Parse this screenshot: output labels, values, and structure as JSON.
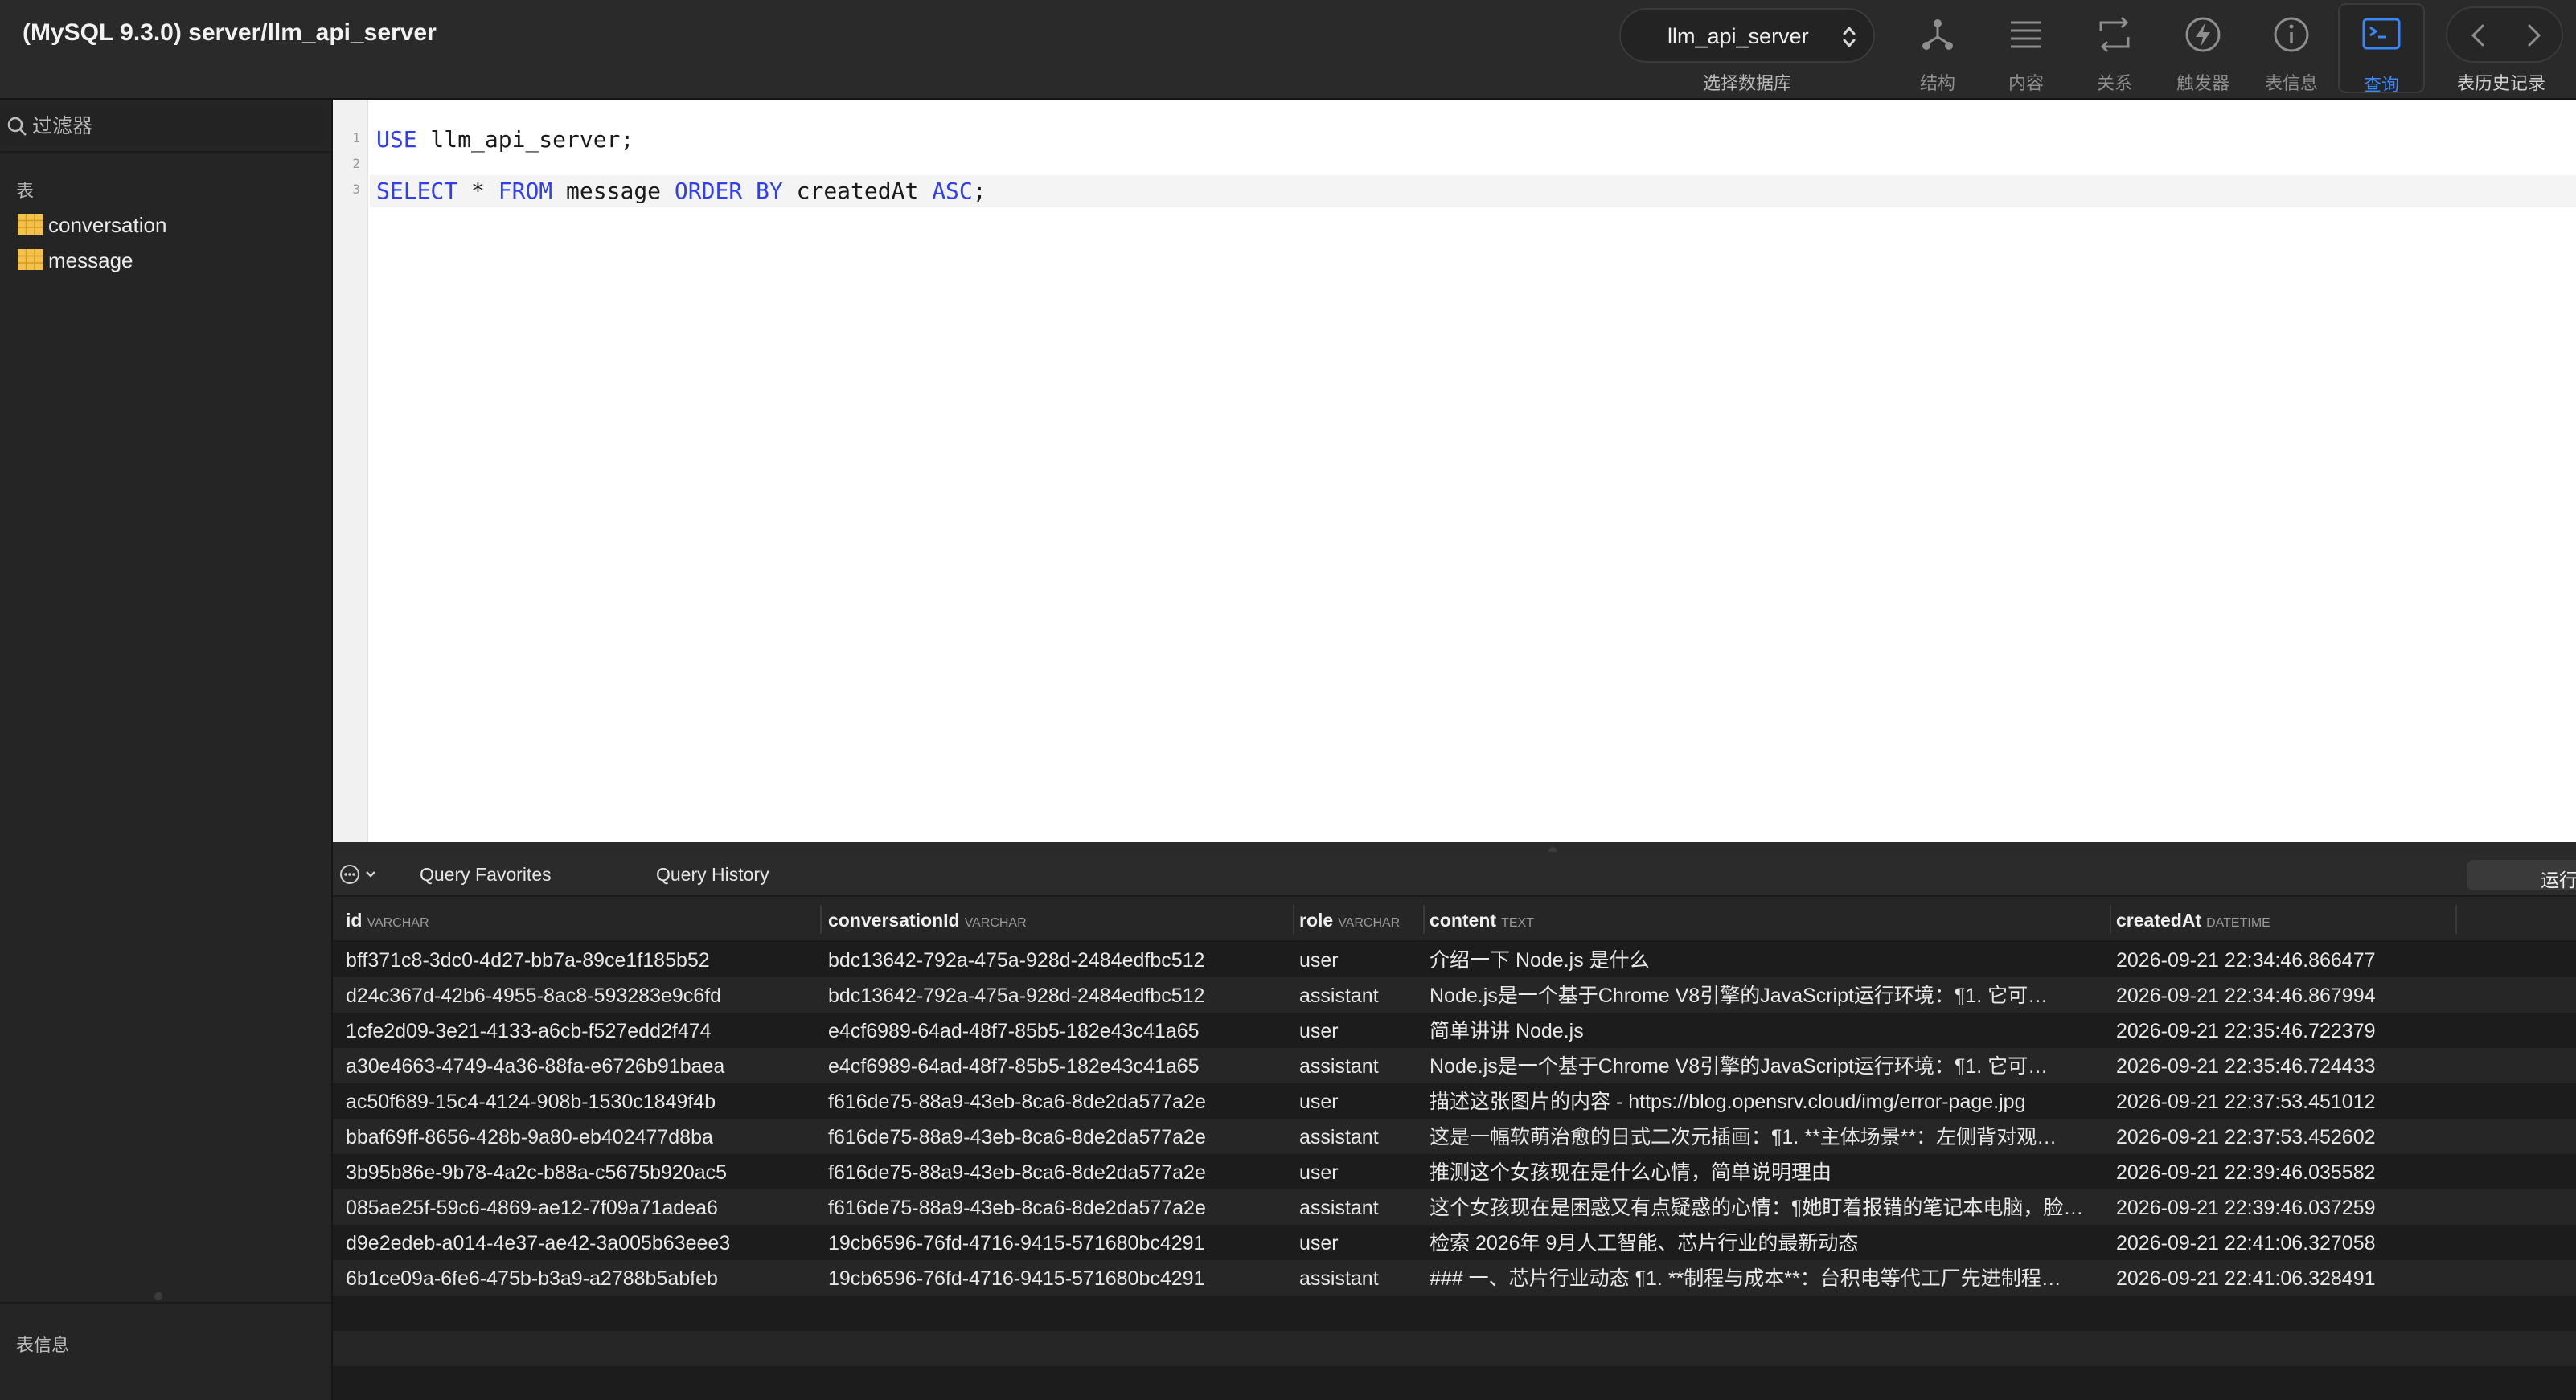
{
  "window": {
    "title": "(MySQL 9.3.0) server/llm_api_server"
  },
  "toolbar": {
    "database": {
      "value": "llm_api_server",
      "label": "选择数据库"
    },
    "tools": [
      {
        "label": "结构",
        "icon": "structure-icon"
      },
      {
        "label": "内容",
        "icon": "content-list-icon"
      },
      {
        "label": "关系",
        "icon": "relations-icon"
      },
      {
        "label": "触发器",
        "icon": "trigger-bolt-icon"
      },
      {
        "label": "表信息",
        "icon": "info-icon"
      },
      {
        "label": "查询",
        "icon": "terminal-icon",
        "active": true
      }
    ],
    "history_label": "表历史记录"
  },
  "sidebar": {
    "filter_placeholder": "过滤器",
    "section_title": "表",
    "tables": [
      "conversation",
      "message"
    ],
    "info_title": "表信息"
  },
  "editor": {
    "lines": [
      {
        "no": "1",
        "tokens": [
          {
            "t": "USE",
            "kw": true
          },
          {
            "t": " llm_api_server;"
          }
        ]
      },
      {
        "no": "2",
        "tokens": []
      },
      {
        "no": "3",
        "tokens": [
          {
            "t": "SELECT",
            "kw": true
          },
          {
            "t": " * "
          },
          {
            "t": "FROM",
            "kw": true
          },
          {
            "t": " message "
          },
          {
            "t": "ORDER BY",
            "kw": true
          },
          {
            "t": " createdAt "
          },
          {
            "t": "ASC",
            "kw": true
          },
          {
            "t": ";"
          }
        ]
      }
    ]
  },
  "results": {
    "tabs": [
      "Query Favorites",
      "Query History"
    ],
    "run_label": "运行",
    "columns": [
      {
        "name": "id",
        "type": "VARCHAR"
      },
      {
        "name": "conversationId",
        "type": "VARCHAR"
      },
      {
        "name": "role",
        "type": "VARCHAR"
      },
      {
        "name": "content",
        "type": "TEXT"
      },
      {
        "name": "createdAt",
        "type": "DATETIME"
      }
    ],
    "rows": [
      [
        "bff371c8-3dc0-4d27-bb7a-89ce1f185b52",
        "bdc13642-792a-475a-928d-2484edfbc512",
        "user",
        "介绍一下 Node.js 是什么",
        "2026-09-21 22:34:46.866477"
      ],
      [
        "d24c367d-42b6-4955-8ac8-593283e9c6fd",
        "bdc13642-792a-475a-928d-2484edfbc512",
        "assistant",
        "Node.js是一个基于Chrome V8引擎的JavaScript运行环境：¶1. 它可…",
        "2026-09-21 22:34:46.867994"
      ],
      [
        "1cfe2d09-3e21-4133-a6cb-f527edd2f474",
        "e4cf6989-64ad-48f7-85b5-182e43c41a65",
        "user",
        "简单讲讲 Node.js",
        "2026-09-21 22:35:46.722379"
      ],
      [
        "a30e4663-4749-4a36-88fa-e6726b91baea",
        "e4cf6989-64ad-48f7-85b5-182e43c41a65",
        "assistant",
        "Node.js是一个基于Chrome V8引擎的JavaScript运行环境：¶1. 它可…",
        "2026-09-21 22:35:46.724433"
      ],
      [
        "ac50f689-15c4-4124-908b-1530c1849f4b",
        "f616de75-88a9-43eb-8ca6-8de2da577a2e",
        "user",
        "描述这张图片的内容 - https://blog.opensrv.cloud/img/error-page.jpg",
        "2026-09-21 22:37:53.451012"
      ],
      [
        "bbaf69ff-8656-428b-9a80-eb402477d8ba",
        "f616de75-88a9-43eb-8ca6-8de2da577a2e",
        "assistant",
        "这是一幅软萌治愈的日式二次元插画：¶1. **主体场景**：左侧背对观…",
        "2026-09-21 22:37:53.452602"
      ],
      [
        "3b95b86e-9b78-4a2c-b88a-c5675b920ac5",
        "f616de75-88a9-43eb-8ca6-8de2da577a2e",
        "user",
        "推测这个女孩现在是什么心情，简单说明理由",
        "2026-09-21 22:39:46.035582"
      ],
      [
        "085ae25f-59c6-4869-ae12-7f09a71adea6",
        "f616de75-88a9-43eb-8ca6-8de2da577a2e",
        "assistant",
        "这个女孩现在是困惑又有点疑惑的心情：¶她盯着报错的笔记本电脑，脸…",
        "2026-09-21 22:39:46.037259"
      ],
      [
        "d9e2edeb-a014-4e37-ae42-3a005b63eee3",
        "19cb6596-76fd-4716-9415-571680bc4291",
        "user",
        "检索 2026年 9月人工智能、芯片行业的最新动态",
        "2026-09-21 22:41:06.327058"
      ],
      [
        "6b1ce09a-6fe6-475b-b3a9-a2788b5abfeb",
        "19cb6596-76fd-4716-9415-571680bc4291",
        "assistant",
        "### 一、芯片行业动态 ¶1. **制程与成本**：台积电等代工厂先进制程…",
        "2026-09-21 22:41:06.328491"
      ]
    ]
  },
  "colors": {
    "accent": "#3b86f7",
    "keyword": "#2f3ff0",
    "table_icon": "#f2c14e"
  }
}
